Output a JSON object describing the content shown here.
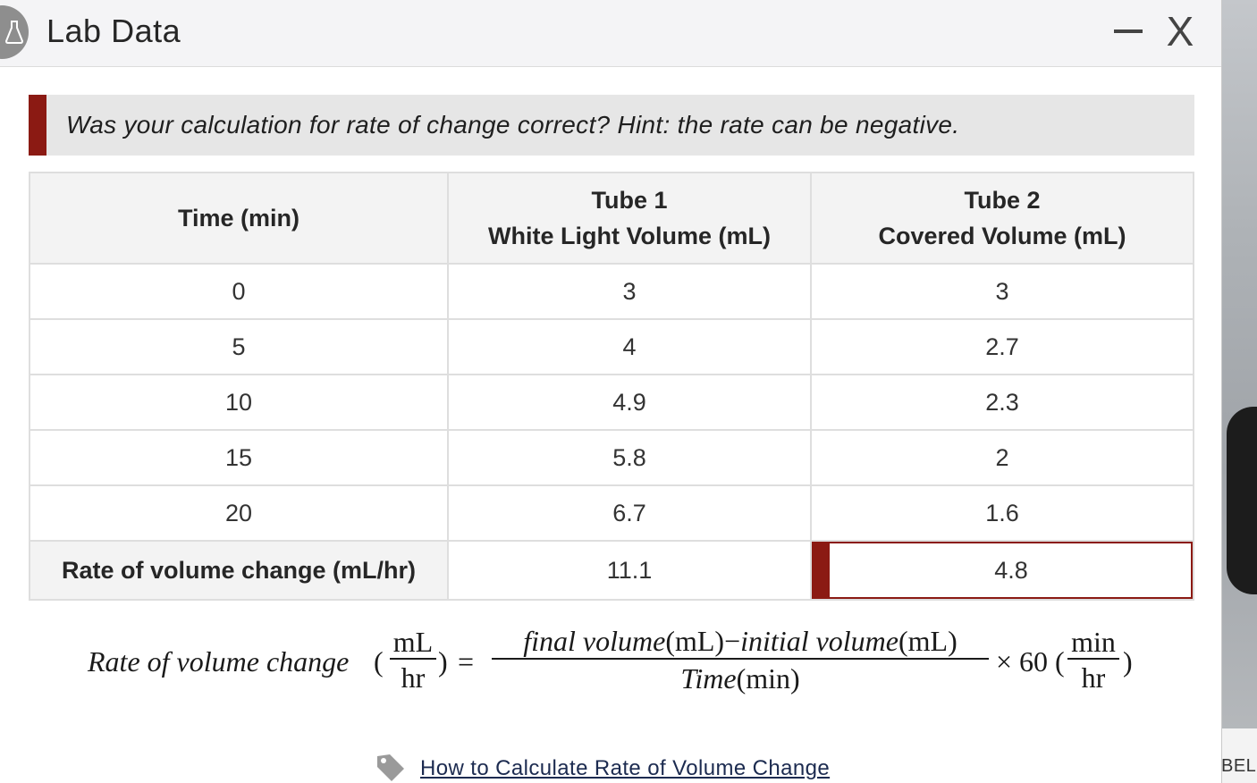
{
  "window": {
    "title": "Lab Data",
    "minimize_label": "—",
    "close_label": "X"
  },
  "hint": {
    "text": "Was your calculation for rate of change correct? Hint: the rate can be negative."
  },
  "table": {
    "headers": {
      "time": "Time (min)",
      "tube1_line1": "Tube 1",
      "tube1_line2": "White Light Volume (mL)",
      "tube2_line1": "Tube 2",
      "tube2_line2": "Covered Volume (mL)"
    },
    "rows": [
      {
        "time": "0",
        "tube1": "3",
        "tube2": "3"
      },
      {
        "time": "5",
        "tube1": "4",
        "tube2": "2.7"
      },
      {
        "time": "10",
        "tube1": "4.9",
        "tube2": "2.3"
      },
      {
        "time": "15",
        "tube1": "5.8",
        "tube2": "2"
      },
      {
        "time": "20",
        "tube1": "6.7",
        "tube2": "1.6"
      }
    ],
    "rate_row": {
      "label": "Rate of volume change (mL/hr)",
      "tube1": "11.1",
      "tube2": "4.8"
    }
  },
  "formula": {
    "lhs": "Rate of volume change",
    "lhs_num": "mL",
    "lhs_den": "hr",
    "equals": "=",
    "numerator_a": "final volume",
    "numerator_a_unit": "(mL)",
    "minus": "−",
    "numerator_b": "initial volume",
    "numerator_b_unit": "(mL)",
    "denominator": "Time",
    "denominator_unit": "(min)",
    "times": "× 60",
    "rhs_num": "min",
    "rhs_den": "hr"
  },
  "link": {
    "text": "How to Calculate Rate of Volume Change"
  },
  "background": {
    "text": "BEL"
  },
  "colors": {
    "error": "#8b1a13",
    "hint_bg": "#e6e6e6",
    "header_bg": "#f3f3f3"
  }
}
